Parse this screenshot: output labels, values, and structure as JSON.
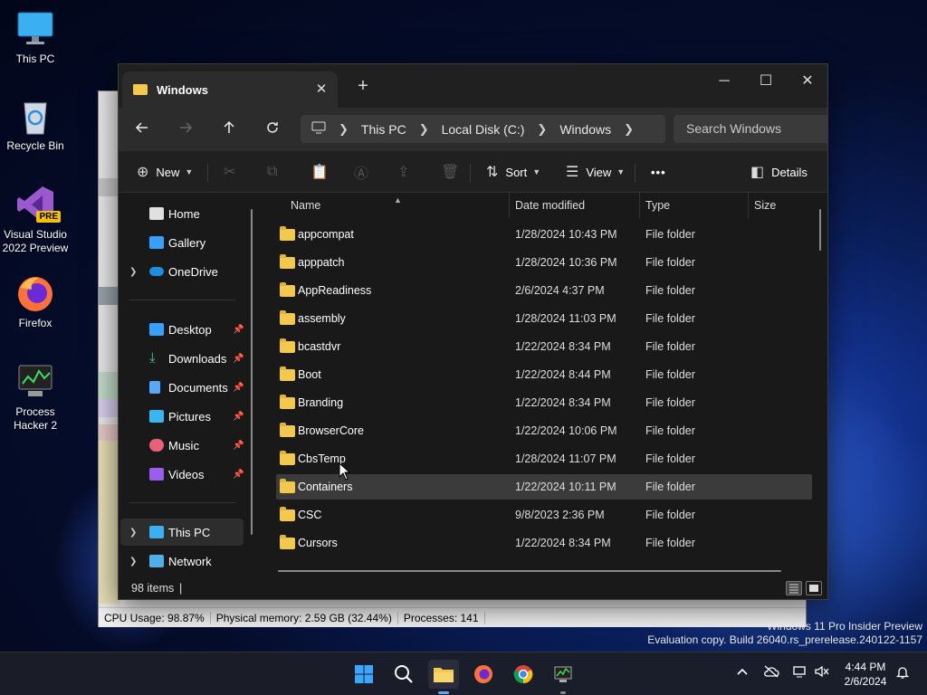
{
  "desktop": {
    "icons": [
      {
        "label": "This PC"
      },
      {
        "label": "Recycle Bin"
      },
      {
        "label": "Visual Studio 2022 Preview",
        "badge": "PRE"
      },
      {
        "label": "Firefox"
      },
      {
        "label": "Process Hacker 2"
      }
    ]
  },
  "bg_window": {
    "status": {
      "cpu": "CPU Usage: 98.87%",
      "memory": "Physical memory: 2.59 GB (32.44%)",
      "processes": "Processes: 141"
    }
  },
  "explorer": {
    "tab_title": "Windows",
    "tab_close": "✕",
    "new_tab": "+",
    "controls": {
      "minimize": "─",
      "maximize": "☐",
      "close": "✕"
    },
    "breadcrumb": [
      "This PC",
      "Local Disk (C:)",
      "Windows"
    ],
    "search_placeholder": "Search Windows",
    "toolbar": {
      "new_label": "New",
      "sort_label": "Sort",
      "view_label": "View",
      "more_label": "•••",
      "details_label": "Details"
    },
    "nav": {
      "home": "Home",
      "gallery": "Gallery",
      "onedrive": "OneDrive",
      "quick_access": [
        "Desktop",
        "Downloads",
        "Documents",
        "Pictures",
        "Music",
        "Videos"
      ],
      "this_pc": "This PC",
      "network": "Network"
    },
    "columns": {
      "name": "Name",
      "date": "Date modified",
      "type": "Type",
      "size": "Size"
    },
    "files": [
      {
        "name": "appcompat",
        "date": "1/28/2024 10:43 PM",
        "type": "File folder"
      },
      {
        "name": "apppatch",
        "date": "1/28/2024 10:36 PM",
        "type": "File folder"
      },
      {
        "name": "AppReadiness",
        "date": "2/6/2024 4:37 PM",
        "type": "File folder"
      },
      {
        "name": "assembly",
        "date": "1/28/2024 11:03 PM",
        "type": "File folder"
      },
      {
        "name": "bcastdvr",
        "date": "1/22/2024 8:34 PM",
        "type": "File folder"
      },
      {
        "name": "Boot",
        "date": "1/22/2024 8:44 PM",
        "type": "File folder"
      },
      {
        "name": "Branding",
        "date": "1/22/2024 8:34 PM",
        "type": "File folder"
      },
      {
        "name": "BrowserCore",
        "date": "1/22/2024 10:06 PM",
        "type": "File folder"
      },
      {
        "name": "CbsTemp",
        "date": "1/28/2024 11:07 PM",
        "type": "File folder"
      },
      {
        "name": "Containers",
        "date": "1/22/2024 10:11 PM",
        "type": "File folder",
        "selected": true
      },
      {
        "name": "CSC",
        "date": "9/8/2023 2:36 PM",
        "type": "File folder"
      },
      {
        "name": "Cursors",
        "date": "1/22/2024 8:34 PM",
        "type": "File folder"
      }
    ],
    "status_count": "98 items"
  },
  "watermark": {
    "line1": "Windows 11 Pro Insider Preview",
    "line2": "Evaluation copy. Build 26040.rs_prerelease.240122-1157"
  },
  "taskbar": {
    "time": "4:44 PM",
    "date": "2/6/2024"
  },
  "colors": {
    "accent": "#60a5fa",
    "folder": "#f2c94c",
    "window_bg": "#191919",
    "selection": "#3b3b3b"
  }
}
